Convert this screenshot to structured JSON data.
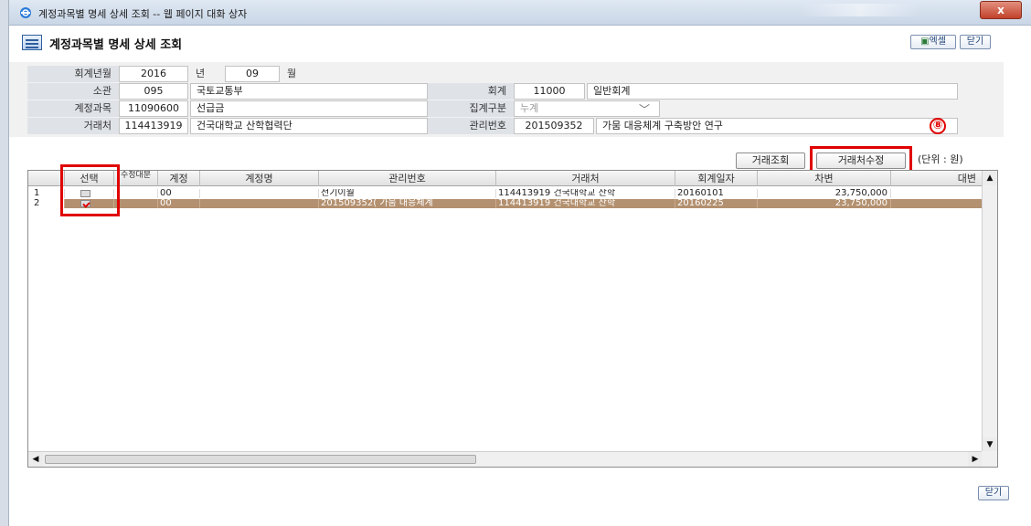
{
  "window": {
    "title": "계정과목별 명세 상세 조회 -- 웹 페이지 대화 상자",
    "close_label": "x"
  },
  "header": {
    "title": "계정과목별 명세 상세 조회",
    "excel_label": "엑셀",
    "close_label": "닫기"
  },
  "form": {
    "year_month_label": "회계년월",
    "year": "2016",
    "year_unit": "년",
    "month": "09",
    "month_unit": "월",
    "ministry_label": "소관",
    "ministry_code": "095",
    "ministry_name": "국토교통부",
    "account_label": "회계",
    "account_code": "11000",
    "account_name": "일반회계",
    "subject_label": "계정과목",
    "subject_code": "11090600",
    "subject_name": "선급금",
    "aggregation_label": "집계구분",
    "aggregation_value": "누계",
    "vendor_label": "거래처",
    "vendor_code": "114413919",
    "vendor_name": "건국대학교 산학협력단",
    "mgmt_label": "관리번호",
    "mgmt_code": "201509352",
    "mgmt_name": "가뭄 대응체계 구축방안 연구"
  },
  "marker": "⑧",
  "actions": {
    "vendor_lookup": "거래조회",
    "vendor_edit": "거래처수정",
    "unit": "(단위 : 원)"
  },
  "grid": {
    "columns": [
      "선택",
      "수정대분",
      "계정",
      "계정명",
      "관리번호",
      "거래처",
      "회계일자",
      "차변",
      "대변"
    ],
    "rows": [
      {
        "no": "1",
        "checked": false,
        "account": "00",
        "account_name": "",
        "mgmt": "전기이월",
        "vendor": "114413919  건국대학교 산학",
        "date": "20160101",
        "debit": "23,750,000",
        "credit": ""
      },
      {
        "no": "2",
        "checked": true,
        "account": "00",
        "account_name": "",
        "mgmt": "201509352( 가뭄 대응체계",
        "vendor": "114413919  건국대학교 산학",
        "date": "20160225",
        "debit": "23,750,000",
        "credit": ""
      }
    ]
  },
  "footer": {
    "close_label": "닫기"
  },
  "icons": {
    "window": "ie-icon",
    "page": "list-icon",
    "excel": "excel-icon"
  },
  "colors": {
    "selected_row": "#b3906f",
    "highlight": "#e00000"
  }
}
